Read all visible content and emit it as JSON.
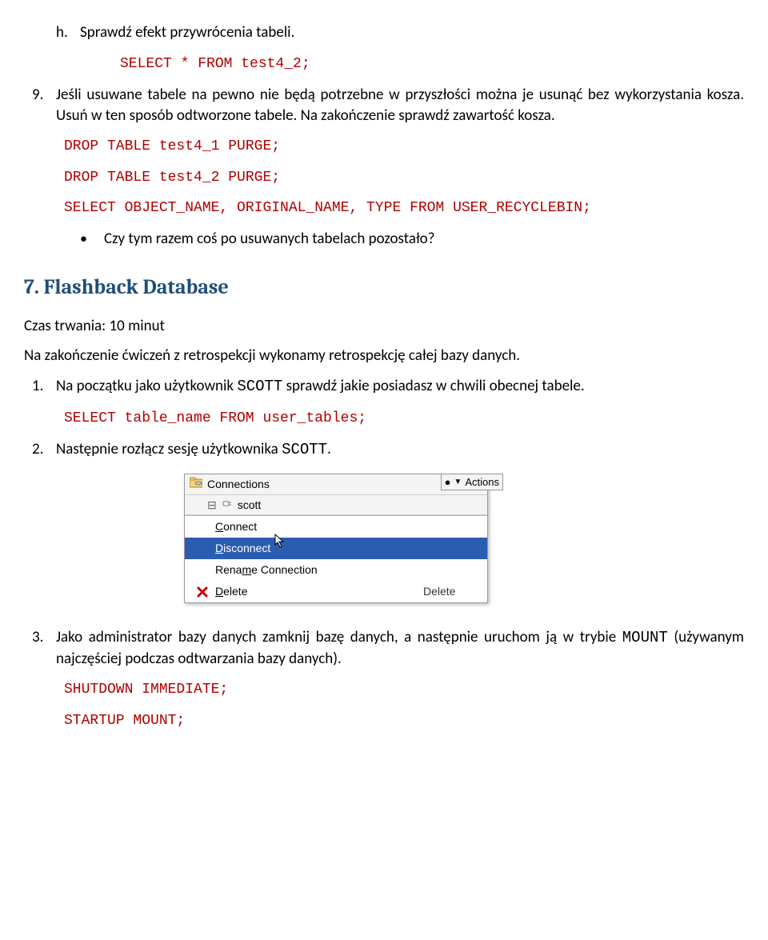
{
  "item_h": {
    "marker": "h.",
    "text": "Sprawdź efekt przywrócenia tabeli.",
    "code": "SELECT * FROM test4_2;"
  },
  "item_9": {
    "marker": "9.",
    "text": "Jeśli usuwane tabele na pewno nie będą potrzebne w przyszłości można je usunąć bez wykorzystania kosza. Usuń w ten sposób odtworzone tabele. Na zakończenie sprawdź zawartość kosza.",
    "code1": "DROP TABLE test4_1 PURGE;",
    "code2": "DROP TABLE test4_2 PURGE;",
    "code3": "SELECT OBJECT_NAME, ORIGINAL_NAME, TYPE FROM USER_RECYCLEBIN;",
    "bullet": "Czy tym razem coś po usuwanych tabelach pozostało?"
  },
  "section7": {
    "heading": "7. Flashback Database",
    "duration": "Czas trwania: 10 minut",
    "intro": "Na zakończenie ćwiczeń z retrospekcji wykonamy retrospekcję całej bazy danych."
  },
  "item_1": {
    "marker": "1.",
    "text_before": "Na początku jako użytkownik ",
    "inline_mono": "SCOTT",
    "text_after": " sprawdź jakie posiadasz w chwili obecnej tabele.",
    "code": "SELECT table_name FROM user_tables;"
  },
  "item_2": {
    "marker": "2.",
    "text_before": "Następnie rozłącz sesję użytkownika ",
    "inline_mono": "SCOTT",
    "text_after": "."
  },
  "menu": {
    "root": "Connections",
    "node": "scott",
    "actions_label": "Actions",
    "connect_full": "Connect",
    "disconnect_full": "Disconnect",
    "rename_full": "Rename Connection",
    "delete_label": "Delete",
    "delete_shortcut": "Delete",
    "connect_u": "C",
    "connect_rest": "onnect",
    "disconnect_u": "D",
    "disconnect_rest": "isconnect",
    "rename_pre": "Rena",
    "rename_u": "m",
    "rename_rest": "e Connection",
    "delete_pre": "",
    "delete_u": "D",
    "delete_rest": "elete"
  },
  "item_3": {
    "marker": "3.",
    "text_before": "Jako administrator bazy danych zamknij bazę danych, a następnie uruchom ją w trybie ",
    "inline_mono": "MOUNT",
    "text_after": " (używanym najczęściej podczas odtwarzania bazy danych).",
    "code1": "SHUTDOWN IMMEDIATE;",
    "code2": "STARTUP MOUNT;"
  }
}
